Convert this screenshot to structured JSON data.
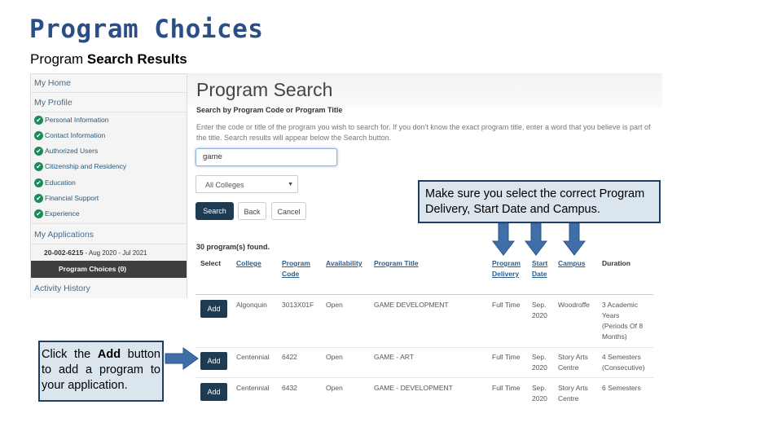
{
  "slide": {
    "title": "Program Choices",
    "subtitle_prefix": "Program ",
    "subtitle_bold": "Search Results"
  },
  "sidebar": {
    "my_home": "My Home",
    "my_profile": "My Profile",
    "profile_items": [
      "Personal Information",
      "Contact Information",
      "Authorized Users",
      "Citizenship and Residency",
      "Education",
      "Financial Support",
      "Experience"
    ],
    "check_glyph": "✔",
    "my_applications": "My Applications",
    "application_code": "20-002-6215",
    "application_dates": " - Aug 2020 - Jul 2021",
    "program_choices": "Program Choices (0)",
    "activity_history": "Activity History"
  },
  "search": {
    "title": "Program Search",
    "heading": "Search by Program Code or Program Title",
    "help": "Enter the code or title of the program you wish to search for. If you don't know the exact program title, enter a word that you believe is part of the title. Search results will appear below the Search button.",
    "query": "game",
    "college_filter": "All Colleges",
    "caret": "▼",
    "search_label": "Search",
    "back_label": "Back",
    "cancel_label": "Cancel",
    "results_count": "30 program(s) found."
  },
  "table": {
    "headers": {
      "select": "Select",
      "college": "College",
      "program_code_1": "Program",
      "program_code_2": "Code",
      "availability": "Availability",
      "program_title": "Program Title",
      "delivery_1": "Program",
      "delivery_2": "Delivery",
      "start_1": "Start",
      "start_2": "Date",
      "campus": "Campus",
      "duration": "Duration"
    },
    "add_label": "Add",
    "rows": [
      {
        "college": "Algonquin",
        "code": "3013X01F",
        "availability": "Open",
        "title": "GAME DEVELOPMENT",
        "delivery": "Full Time",
        "start_1": "Sep.",
        "start_2": "2020",
        "campus_1": "Woodroffe",
        "campus_2": "",
        "duration": [
          "3 Academic",
          "Years",
          "(Periods Of 8",
          "Months)"
        ]
      },
      {
        "college": "Centennial",
        "code": "6422",
        "availability": "Open",
        "title": "GAME - ART",
        "delivery": "Full Time",
        "start_1": "Sep.",
        "start_2": "2020",
        "campus_1": "Story Arts",
        "campus_2": "Centre",
        "duration": [
          "4 Semesters",
          "(Consecutive)"
        ]
      },
      {
        "college": "Centennial",
        "code": "6432",
        "availability": "Open",
        "title": "GAME - DEVELOPMENT",
        "delivery": "Full Time",
        "start_1": "Sep.",
        "start_2": "2020",
        "campus_1": "Story Arts",
        "campus_2": "Centre",
        "duration": [
          "6 Semesters"
        ]
      }
    ]
  },
  "callouts": {
    "top_line1": "Make sure you select the correct Program",
    "top_line2": "Delivery, Start Date and Campus.",
    "left_prefix": "Click the ",
    "left_bold": "Add",
    "left_suffix": " button to add a program to your application."
  },
  "colors": {
    "title": "#2a4f86",
    "arrow": "#3f6ea8",
    "dark_button": "#1f3b52",
    "link": "#2c5e8a"
  }
}
